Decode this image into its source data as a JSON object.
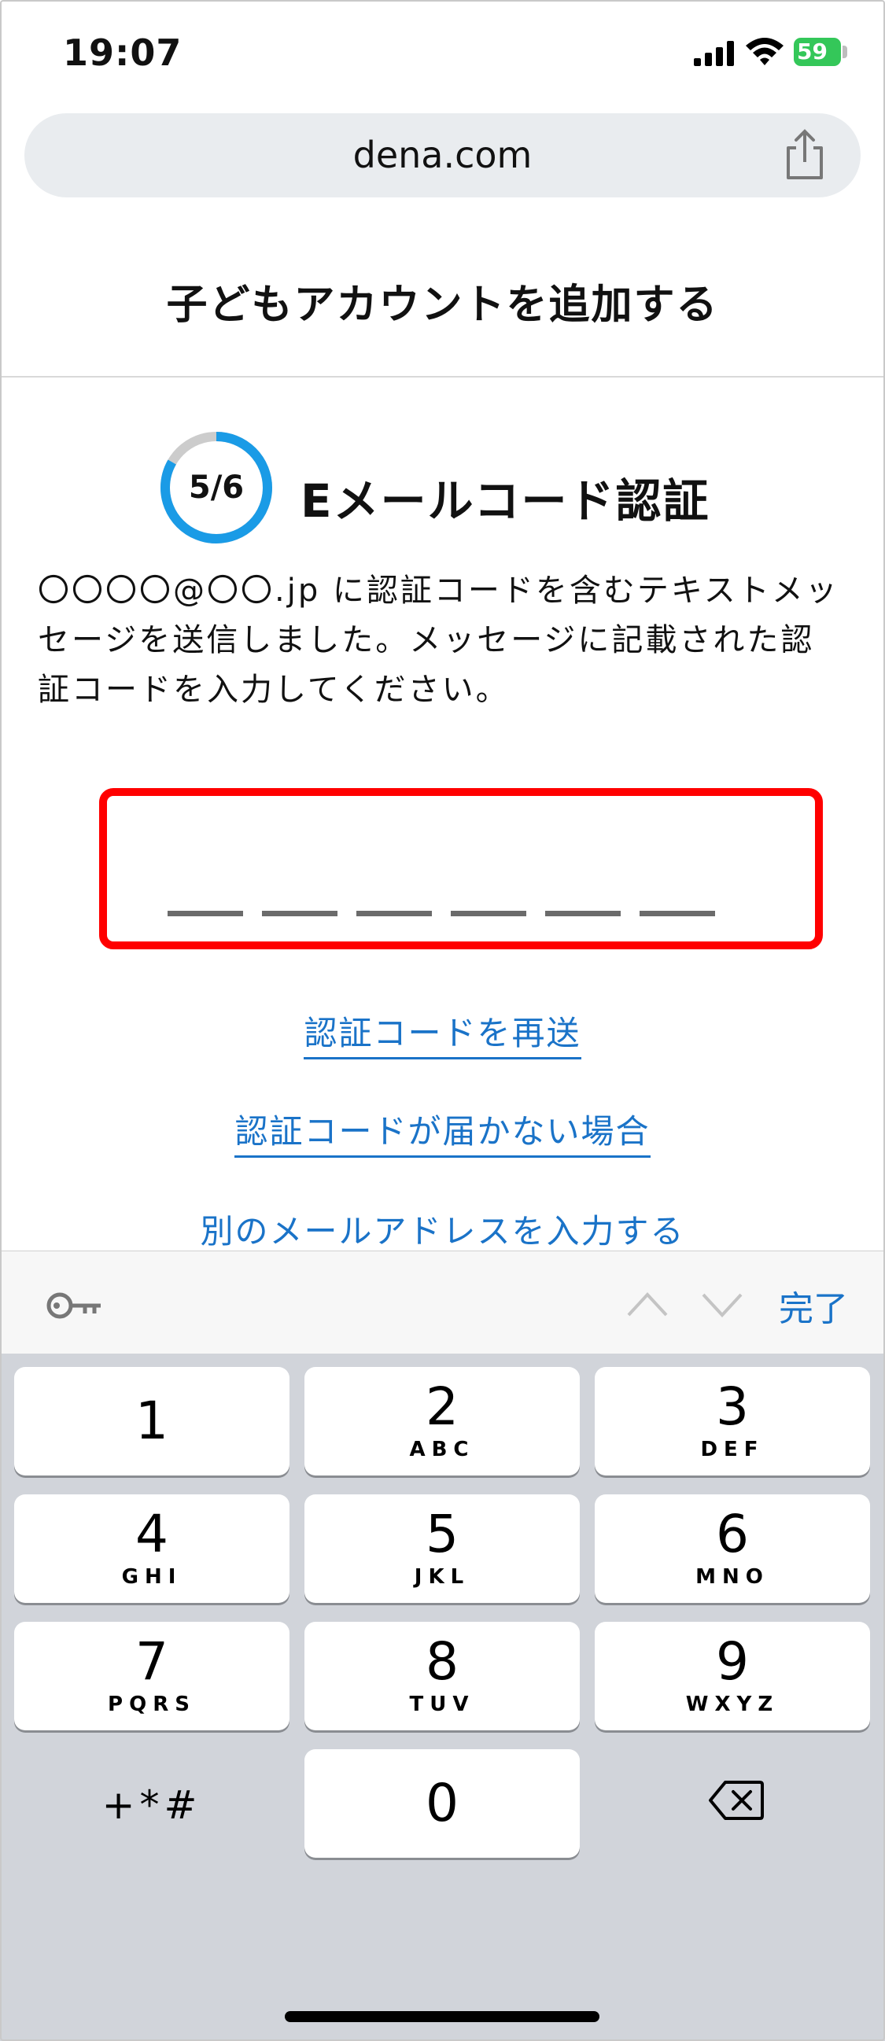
{
  "status_bar": {
    "time": "19:07",
    "battery": "59"
  },
  "browser": {
    "url": "dena.com"
  },
  "page": {
    "title": "子どもアカウントを追加する"
  },
  "step": {
    "label": "5/6",
    "progress": 0.833,
    "title": "Eメールコード認証"
  },
  "description": "〇〇〇〇@〇〇.jp に認証コードを含むテキストメッセージを送信しました。メッセージに記載された認証コードを入力してください。",
  "links": {
    "resend": "認証コードを再送",
    "not_received": "認証コードが届かない場合",
    "other_email": "別のメールアドレスを入力する"
  },
  "accessory": {
    "done": "完了"
  },
  "keypad": {
    "keys": [
      {
        "num": "1",
        "letters": ""
      },
      {
        "num": "2",
        "letters": "ABC"
      },
      {
        "num": "3",
        "letters": "DEF"
      },
      {
        "num": "4",
        "letters": "GHI"
      },
      {
        "num": "5",
        "letters": "JKL"
      },
      {
        "num": "6",
        "letters": "MNO"
      },
      {
        "num": "7",
        "letters": "PQRS"
      },
      {
        "num": "8",
        "letters": "TUV"
      },
      {
        "num": "9",
        "letters": "WXYZ"
      },
      {
        "num": "0",
        "letters": ""
      }
    ],
    "symbols": "+*#"
  },
  "colors": {
    "accent": "#1a73c8",
    "highlight_border": "#ff0000",
    "progress_ring": "#1a9be6",
    "battery": "#34c759"
  }
}
